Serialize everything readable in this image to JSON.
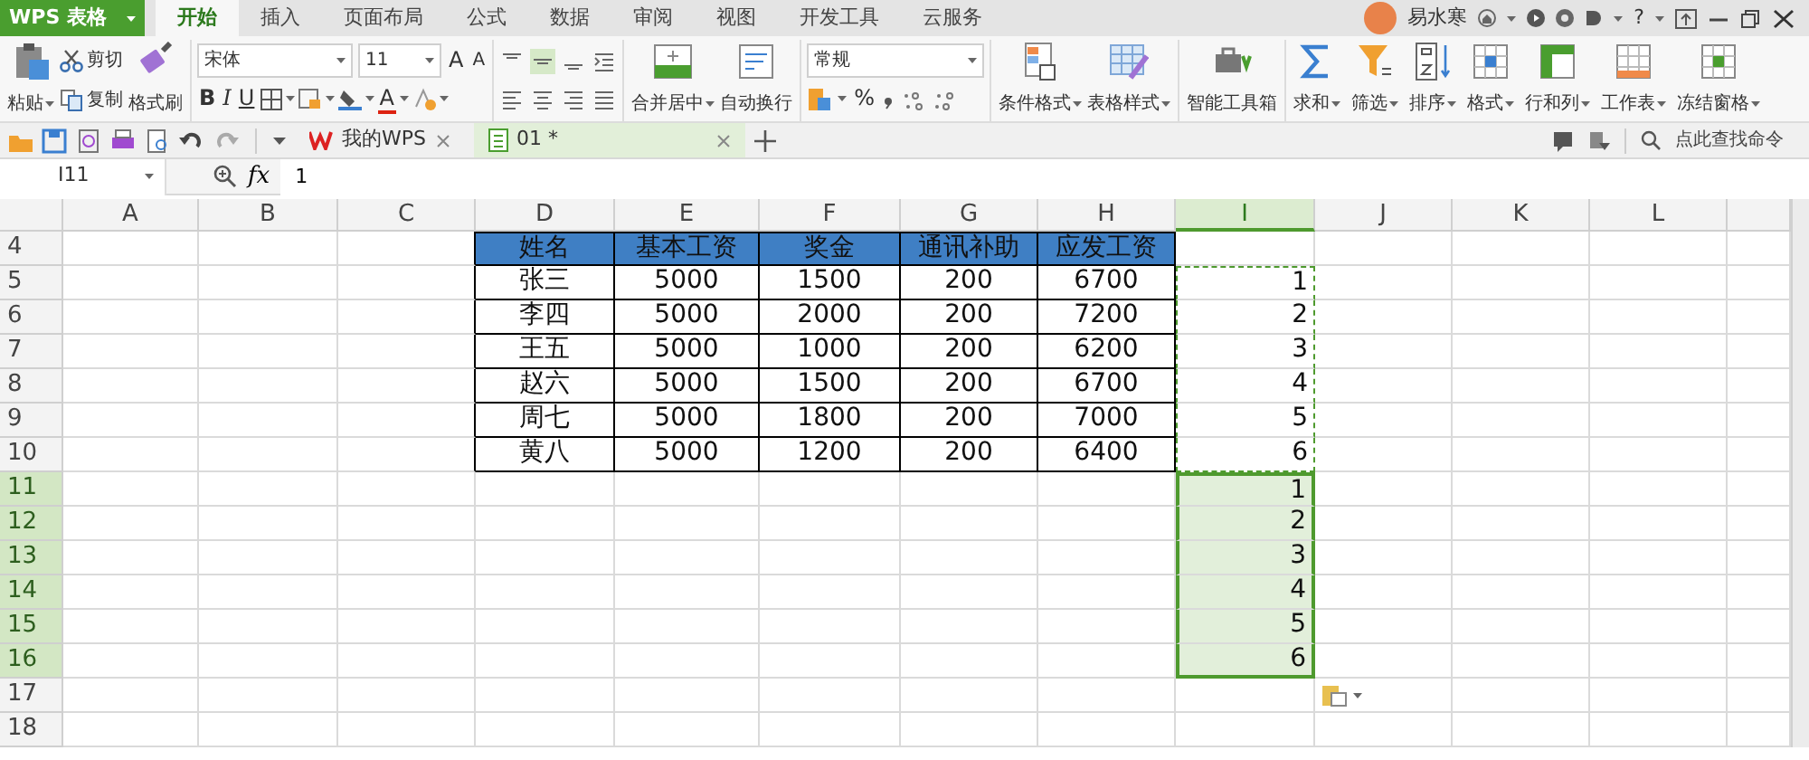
{
  "app_menu": {
    "label": "WPS 表格"
  },
  "menu_tabs": [
    {
      "label": "开始",
      "selected": true
    },
    {
      "label": "插入",
      "selected": false
    },
    {
      "label": "页面布局",
      "selected": false
    },
    {
      "label": "公式",
      "selected": false
    },
    {
      "label": "数据",
      "selected": false
    },
    {
      "label": "审阅",
      "selected": false
    },
    {
      "label": "视图",
      "selected": false
    },
    {
      "label": "开发工具",
      "selected": false
    },
    {
      "label": "云服务",
      "selected": false
    }
  ],
  "user": {
    "name": "易水寒",
    "help": "?"
  },
  "clipboard": {
    "paste": "粘贴",
    "cut": "剪切",
    "copy": "复制",
    "format_painter": "格式刷"
  },
  "font": {
    "name": "宋体",
    "size": "11",
    "grow": "A",
    "shrink": "A",
    "bold": "B",
    "italic": "I",
    "underline": "U",
    "font_color": "A"
  },
  "vertical_align_buttons": [
    {
      "selected": false
    },
    {
      "selected": true
    },
    {
      "selected": false
    }
  ],
  "merge": {
    "merge_center": "合并居中",
    "wrap_text": "自动换行"
  },
  "number": {
    "format": "常规",
    "percent": "%"
  },
  "tool_buttons": [
    {
      "label": "条件格式",
      "dropdown": true
    },
    {
      "label": "表格样式",
      "dropdown": true
    },
    {
      "label": "智能工具箱",
      "dropdown": false
    },
    {
      "label": "求和",
      "dropdown": true
    },
    {
      "label": "筛选",
      "dropdown": true
    },
    {
      "label": "排序",
      "dropdown": true
    },
    {
      "label": "格式",
      "dropdown": true
    },
    {
      "label": "行和列",
      "dropdown": true
    },
    {
      "label": "工作表",
      "dropdown": true
    },
    {
      "label": "冻结窗格",
      "dropdown": true
    }
  ],
  "doc_tabs": [
    {
      "label": "我的WPS",
      "selected": false
    },
    {
      "label": "01 *",
      "selected": true
    }
  ],
  "command_search": {
    "placeholder": "点此查找命令"
  },
  "formula_bar": {
    "cell_ref": "I11",
    "fx": "fx",
    "value": "1"
  },
  "sheet": {
    "columns": [
      {
        "label": "A",
        "selected": false
      },
      {
        "label": "B",
        "selected": false
      },
      {
        "label": "C",
        "selected": false
      },
      {
        "label": "D",
        "selected": false
      },
      {
        "label": "E",
        "selected": false
      },
      {
        "label": "F",
        "selected": false
      },
      {
        "label": "G",
        "selected": false
      },
      {
        "label": "H",
        "selected": false
      },
      {
        "label": "I",
        "selected": true
      },
      {
        "label": "J",
        "selected": false
      },
      {
        "label": "K",
        "selected": false
      },
      {
        "label": "L",
        "selected": false
      }
    ],
    "rows": [
      {
        "label": "4",
        "selected": false
      },
      {
        "label": "5",
        "selected": false
      },
      {
        "label": "6",
        "selected": false
      },
      {
        "label": "7",
        "selected": false
      },
      {
        "label": "8",
        "selected": false
      },
      {
        "label": "9",
        "selected": false
      },
      {
        "label": "10",
        "selected": false
      },
      {
        "label": "11",
        "selected": true
      },
      {
        "label": "12",
        "selected": true
      },
      {
        "label": "13",
        "selected": true
      },
      {
        "label": "14",
        "selected": true
      },
      {
        "label": "15",
        "selected": true
      },
      {
        "label": "16",
        "selected": true
      },
      {
        "label": "17",
        "selected": false
      },
      {
        "label": "18",
        "selected": false
      }
    ],
    "table": {
      "header": [
        "姓名",
        "基本工资",
        "奖金",
        "通讯补助",
        "应发工资"
      ],
      "rows": [
        [
          "张三",
          "5000",
          "1500",
          "200",
          "6700"
        ],
        [
          "李四",
          "5000",
          "2000",
          "200",
          "7200"
        ],
        [
          "王五",
          "5000",
          "1000",
          "200",
          "6200"
        ],
        [
          "赵六",
          "5000",
          "1500",
          "200",
          "6700"
        ],
        [
          "周七",
          "5000",
          "1800",
          "200",
          "7000"
        ],
        [
          "黄八",
          "5000",
          "1200",
          "200",
          "6400"
        ]
      ]
    },
    "i_column_cells": [
      {
        "text": "1",
        "selected": false,
        "copied": true
      },
      {
        "text": "2",
        "selected": false,
        "copied": true
      },
      {
        "text": "3",
        "selected": false,
        "copied": true
      },
      {
        "text": "4",
        "selected": false,
        "copied": true
      },
      {
        "text": "5",
        "selected": false,
        "copied": true
      },
      {
        "text": "6",
        "selected": false,
        "copied": true
      },
      {
        "text": "1",
        "selected": true,
        "copied": false
      },
      {
        "text": "2",
        "selected": true,
        "copied": false
      },
      {
        "text": "3",
        "selected": true,
        "copied": false
      },
      {
        "text": "4",
        "selected": true,
        "copied": false
      },
      {
        "text": "5",
        "selected": true,
        "copied": false
      },
      {
        "text": "6",
        "selected": true,
        "copied": false
      }
    ]
  }
}
